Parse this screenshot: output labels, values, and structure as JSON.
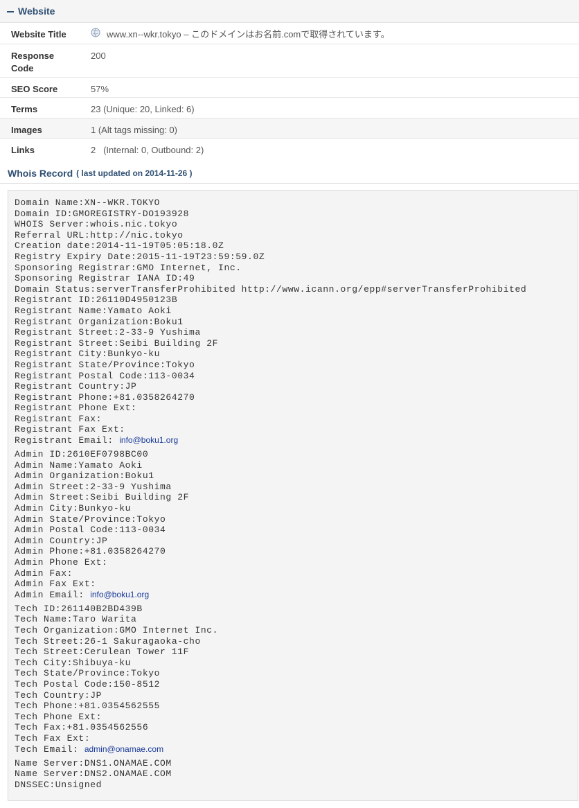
{
  "website": {
    "section_title": "Website",
    "rows": [
      {
        "label": "Website Title",
        "value": "www.xn--wkr.tokyo – このドメインはお名前.comで取得されています。"
      },
      {
        "label": "Response Code",
        "value": "200"
      },
      {
        "label": "SEO Score",
        "value": "57%"
      },
      {
        "label": "Terms",
        "value": "23 (Unique: 20, Linked: 6)"
      },
      {
        "label": "Images",
        "value": "1 (Alt tags missing: 0)"
      },
      {
        "label": "Links",
        "value": "2   (Internal: 0, Outbound: 2)"
      }
    ]
  },
  "whois": {
    "title": "Whois Record",
    "subtitle": "( last updated on 2014-11-26 )",
    "lines": [
      "Domain Name:XN--WKR.TOKYO",
      "Domain ID:GMOREGISTRY-DO193928",
      "WHOIS Server:whois.nic.tokyo",
      "Referral URL:http://nic.tokyo",
      "Creation date:2014-11-19T05:05:18.0Z",
      "Registry Expiry Date:2015-11-19T23:59:59.0Z",
      "Sponsoring Registrar:GMO Internet, Inc.",
      "Sponsoring Registrar IANA ID:49",
      "Domain Status:serverTransferProhibited http://www.icann.org/epp#serverTransferProhibited",
      "Registrant ID:26110D4950123B",
      "Registrant Name:Yamato Aoki",
      "Registrant Organization:Boku1",
      "Registrant Street:2-33-9 Yushima",
      "Registrant Street:Seibi Building 2F",
      "Registrant City:Bunkyo-ku",
      "Registrant State/Province:Tokyo",
      "Registrant Postal Code:113-0034",
      "Registrant Country:JP",
      "Registrant Phone:+81.0358264270",
      "Registrant Phone Ext:",
      "Registrant Fax:",
      "Registrant Fax Ext:",
      "Registrant Email: ",
      "Admin ID:2610EF0798BC00",
      "Admin Name:Yamato Aoki",
      "Admin Organization:Boku1",
      "Admin Street:2-33-9 Yushima",
      "Admin Street:Seibi Building 2F",
      "Admin City:Bunkyo-ku",
      "Admin State/Province:Tokyo",
      "Admin Postal Code:113-0034",
      "Admin Country:JP",
      "Admin Phone:+81.0358264270",
      "Admin Phone Ext:",
      "Admin Fax:",
      "Admin Fax Ext:",
      "Admin Email: ",
      "Tech ID:261140B2BD439B",
      "Tech Name:Taro Warita",
      "Tech Organization:GMO Internet Inc.",
      "Tech Street:26-1 Sakuragaoka-cho",
      "Tech Street:Cerulean Tower 11F",
      "Tech City:Shibuya-ku",
      "Tech State/Province:Tokyo",
      "Tech Postal Code:150-8512",
      "Tech Country:JP",
      "Tech Phone:+81.0354562555",
      "Tech Phone Ext:",
      "Tech Fax:+81.0354562556",
      "Tech Fax Ext:",
      "Tech Email: ",
      "Name Server:DNS1.ONAMAE.COM",
      "Name Server:DNS2.ONAMAE.COM",
      "DNSSEC:Unsigned"
    ],
    "emails": {
      "registrant": "info@boku1.org",
      "admin": "info@boku1.org",
      "tech": "admin@onamae.com"
    }
  },
  "icons": {
    "collapse": "minus-icon",
    "website_title": "globe-icon"
  },
  "colors": {
    "heading": "#2f4f73",
    "link": "#1a3a9a",
    "row_shade": "#f6f6f6"
  }
}
